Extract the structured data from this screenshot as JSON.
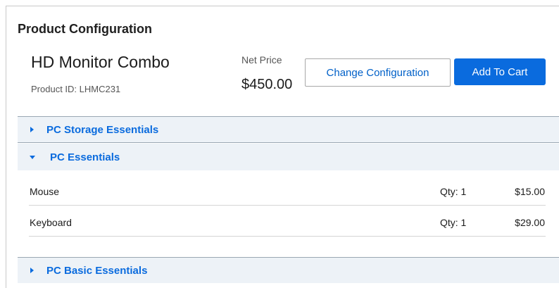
{
  "card": {
    "title": "Product Configuration"
  },
  "product": {
    "name": "HD Monitor Combo",
    "id_text": "Product ID: LHMC231",
    "price_label": "Net Price",
    "price": "$450.00"
  },
  "actions": {
    "change_configuration": "Change Configuration",
    "add_to_cart": "Add To Cart"
  },
  "sections": [
    {
      "label": "PC Storage Essentials",
      "expanded": false,
      "items": []
    },
    {
      "label": "PC Essentials",
      "expanded": true,
      "items": [
        {
          "name": "Mouse",
          "qty": "Qty: 1",
          "price": "$15.00"
        },
        {
          "name": "Keyboard",
          "qty": "Qty: 1",
          "price": "$29.00"
        }
      ]
    },
    {
      "label": "PC Basic Essentials",
      "expanded": false,
      "items": []
    }
  ],
  "colors": {
    "accent": "#0a6bde",
    "section_background": "#edf2f7",
    "border": "#c9c9c9"
  },
  "icons": {
    "collapsed": "caret-right-icon",
    "expanded": "caret-down-icon"
  }
}
